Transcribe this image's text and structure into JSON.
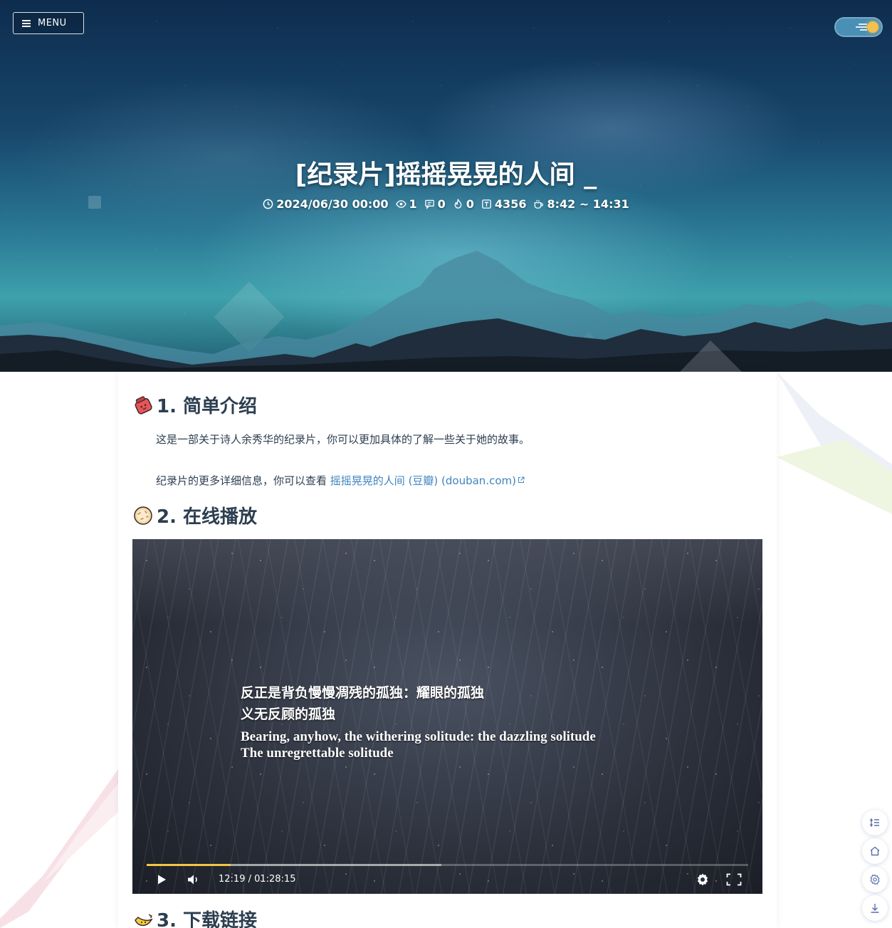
{
  "header": {
    "menu_label": "MENU",
    "title": "[纪录片]摇摇晃晃的人间 _",
    "meta": {
      "date": "2024/06/30 00:00",
      "views": "1",
      "comments": "0",
      "likes": "0",
      "word_count": "4356",
      "reading_time": "8:42 ~ 14:31"
    }
  },
  "article": {
    "sections": [
      {
        "heading": "1. 简单介绍",
        "icon": "red-bag-emoji-icon"
      },
      {
        "heading": "2. 在线播放",
        "icon": "cookie-emoji-icon"
      },
      {
        "heading": "3. 下载链接",
        "icon": "banana-emoji-icon"
      }
    ],
    "intro_paragraph": "这是一部关于诗人余秀华的纪录片，你可以更加具体的了解一些关于她的故事。",
    "detail_prefix": "纪录片的更多详细信息，你可以查看",
    "detail_link_text": "摇摇晃晃的人间 (豆瓣) (douban.com)"
  },
  "video": {
    "subtitle_cn_line1": "反正是背负慢慢凋残的孤独：耀眼的孤独",
    "subtitle_cn_line2": "义无反顾的孤独",
    "subtitle_en_line1": "Bearing, anyhow, the withering solitude: the dazzling solitude",
    "subtitle_en_line2": "The unregrettable solitude",
    "time": "12:19 / 01:28:15",
    "played_fraction": 0.14,
    "buffered_fraction": 0.49
  },
  "colors": {
    "accent": "#f5c443",
    "link": "#3e84c0",
    "heading": "#2c3e50"
  },
  "floating_tools": [
    "toc-icon",
    "home-icon",
    "settings-icon",
    "download-icon"
  ]
}
